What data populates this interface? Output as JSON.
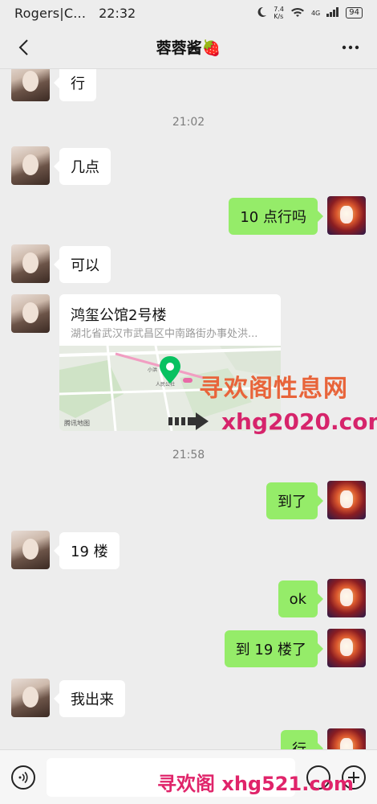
{
  "status_bar": {
    "carrier": "Rogers|C...",
    "time": "22:32",
    "speed": "7.4\nK/s",
    "network": "4G",
    "battery": "94"
  },
  "header": {
    "title": "蓉蓉酱🍓"
  },
  "messages": [
    {
      "side": "left",
      "text": "行"
    },
    {
      "type": "time",
      "text": "21:02"
    },
    {
      "side": "left",
      "text": "几点"
    },
    {
      "side": "right",
      "text": "10 点行吗"
    },
    {
      "side": "left",
      "text": "可以"
    },
    {
      "side": "left",
      "type": "location",
      "name": "鸿玺公馆2号楼",
      "address": "湖北省武汉市武昌区中南路街办事处洪..."
    },
    {
      "type": "time",
      "text": "21:58"
    },
    {
      "side": "right",
      "text": "到了"
    },
    {
      "side": "left",
      "text": "19 楼"
    },
    {
      "side": "right",
      "text": "ok"
    },
    {
      "side": "right",
      "text": "到 19 楼了"
    },
    {
      "side": "left",
      "text": "我出来"
    },
    {
      "side": "right",
      "text": "行"
    }
  ],
  "watermarks": {
    "line1": "寻欢阁性息网",
    "line2": "xhg2020.com",
    "line3": "寻欢阁 xhg521.com"
  },
  "map_logo": "腾讯地图",
  "colors": {
    "background": "#ededed",
    "bubble_self": "#95ec69",
    "bubble_other": "#ffffff",
    "pin": "#07c160"
  }
}
